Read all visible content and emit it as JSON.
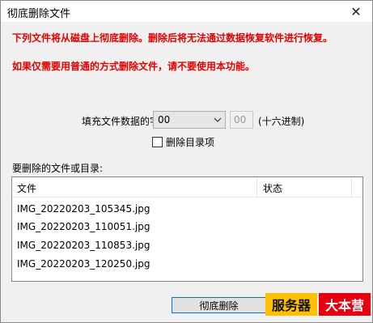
{
  "window": {
    "title": "彻底删除文件"
  },
  "warnings": {
    "line1": "下列文件将从磁盘上彻底删除。删除后将无法通过数据恢复软件进行恢复。",
    "line2": "如果仅需要用普通的方式删除文件，请不要使用本功能。"
  },
  "fill": {
    "label": "填充文件数据的字符:",
    "selected_value": "00",
    "hex_value": "00",
    "hex_hint": "(十六进制)"
  },
  "options": {
    "delete_dirs_label": "删除目录项",
    "delete_dirs_checked": false
  },
  "list": {
    "label": "要删除的文件或目录:",
    "columns": [
      "文件",
      "状态"
    ],
    "rows": [
      {
        "file": "IMG_20220203_105345.jpg",
        "status": ""
      },
      {
        "file": "IMG_20220203_110051.jpg",
        "status": ""
      },
      {
        "file": "IMG_20220203_110853.jpg",
        "status": ""
      },
      {
        "file": "IMG_20220203_120250.jpg",
        "status": ""
      }
    ]
  },
  "buttons": {
    "delete_label": "彻底删除"
  },
  "watermark": {
    "text1": "服务器",
    "text2": "大本营"
  },
  "colors": {
    "warning_text": "#e60000",
    "focus_border": "#0078d7",
    "watermark_yellow": "#ffc000",
    "watermark_red": "#e60012"
  },
  "icons": {
    "close": "close-icon",
    "dropdown": "chevron-down-icon"
  }
}
